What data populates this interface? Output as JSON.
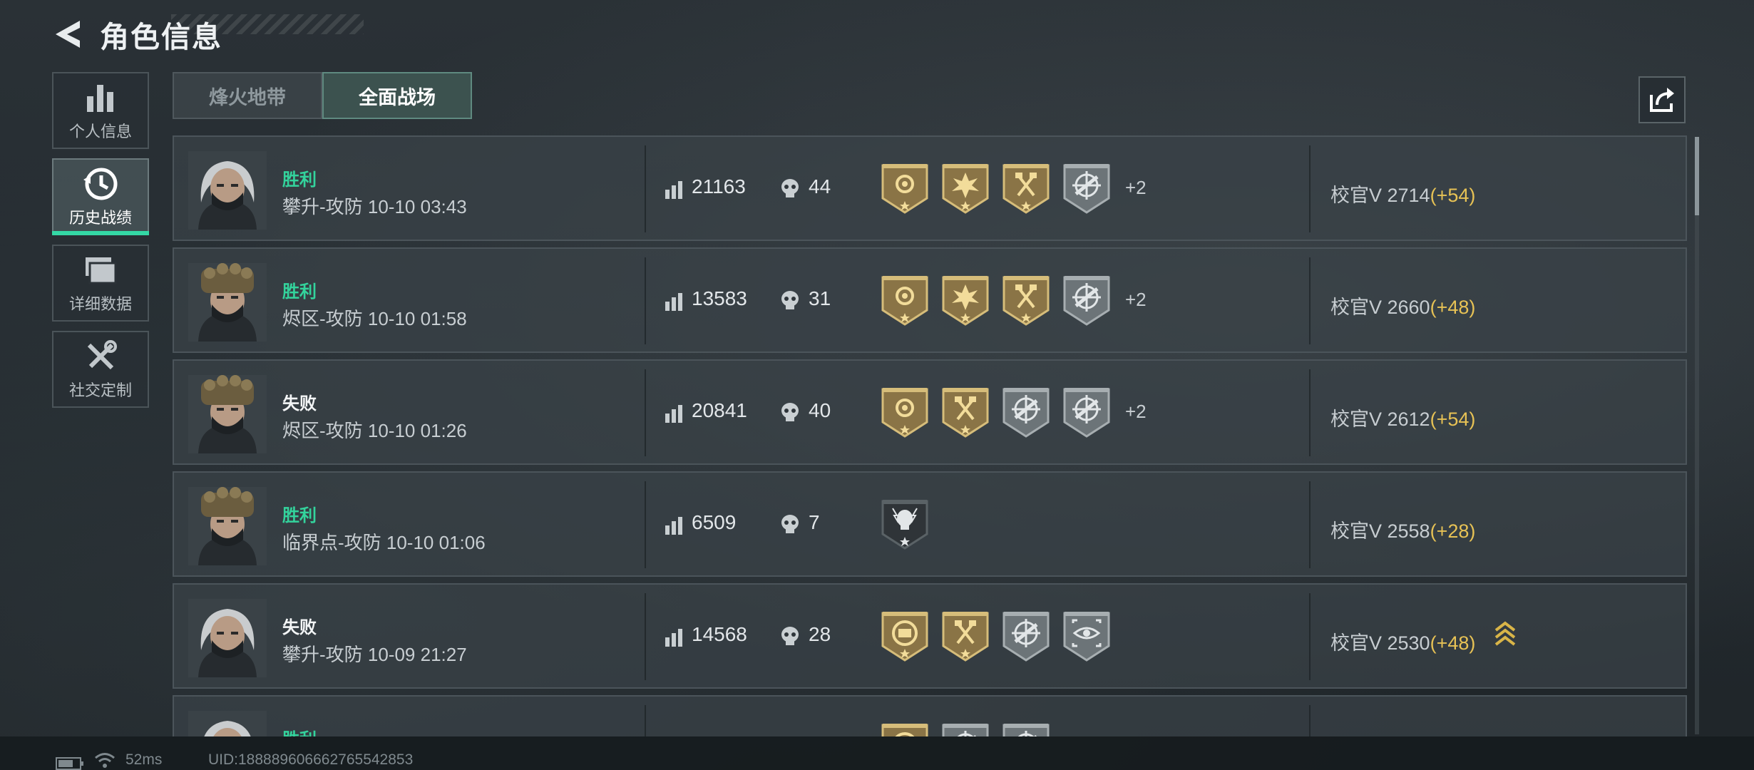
{
  "header": {
    "title": "角色信息",
    "back_icon": "back-arrow-icon"
  },
  "sidebar": {
    "items": [
      {
        "label": "个人信息",
        "icon": "bar-chart-icon",
        "active": false
      },
      {
        "label": "历史战绩",
        "icon": "history-clock-icon",
        "active": true
      },
      {
        "label": "详细数据",
        "icon": "folder-stack-icon",
        "active": false
      },
      {
        "label": "社交定制",
        "icon": "wrench-screwdriver-icon",
        "active": false
      }
    ]
  },
  "tabs": [
    {
      "label": "烽火地带",
      "active": false
    },
    {
      "label": "全面战场",
      "active": true
    }
  ],
  "share_icon": "share-export-icon",
  "colors": {
    "win": "#33d39c",
    "accent": "#34d8a5",
    "rank_delta": "#e7c255"
  },
  "matches": [
    {
      "result": "胜利",
      "outcome": "win",
      "map_line": "攀升-攻防 10-10 03:43",
      "avatar": "female-operator",
      "score": "21163",
      "kills": "44",
      "medals": [
        "gold-rose",
        "gold-burst",
        "gold-axes",
        "gray-crosshair-rifle"
      ],
      "more": "+2",
      "rank_text": "校官V 2714",
      "rank_delta": "(+54)",
      "rank_up": false
    },
    {
      "result": "胜利",
      "outcome": "win",
      "map_line": "烬区-攻防 10-10 01:58",
      "avatar": "male-operator",
      "score": "13583",
      "kills": "31",
      "medals": [
        "gold-rose",
        "gold-burst",
        "gold-axes",
        "gray-crosshair-rifle"
      ],
      "more": "+2",
      "rank_text": "校官V 2660",
      "rank_delta": "(+48)",
      "rank_up": false
    },
    {
      "result": "失败",
      "outcome": "lose",
      "map_line": "烬区-攻防 10-10 01:26",
      "avatar": "male-operator",
      "score": "20841",
      "kills": "40",
      "medals": [
        "gold-rose",
        "gold-axes",
        "gray-crosshair-rifle",
        "gray-crosshair-rifle"
      ],
      "more": "+2",
      "rank_text": "校官V 2612",
      "rank_delta": "(+54)",
      "rank_up": false
    },
    {
      "result": "胜利",
      "outcome": "win",
      "map_line": "临界点-攻防 10-10 01:06",
      "avatar": "male-operator",
      "score": "6509",
      "kills": "7",
      "medals": [
        "dark-skull-lightning"
      ],
      "more": "",
      "rank_text": "校官V 2558",
      "rank_delta": "(+28)",
      "rank_up": false
    },
    {
      "result": "失败",
      "outcome": "lose",
      "map_line": "攀升-攻防 10-09 21:27",
      "avatar": "female-operator",
      "score": "14568",
      "kills": "28",
      "medals": [
        "gold-radio",
        "gold-axes",
        "gray-crosshair-rifle",
        "gray-eye-target"
      ],
      "more": "",
      "rank_text": "校官V 2530",
      "rank_delta": "(+48)",
      "rank_up": true
    },
    {
      "result": "胜利",
      "outcome": "win",
      "map_line": "",
      "avatar": "female-operator",
      "score": "",
      "kills": "",
      "medals": [
        "gold-radio",
        "gray-crosshair-rifle",
        "gray-crosshair-rifle"
      ],
      "more": "",
      "rank_text": "",
      "rank_delta": "",
      "rank_up": false
    }
  ],
  "status": {
    "ping": "52ms",
    "uid": "UID:18888960666276554285​3"
  }
}
